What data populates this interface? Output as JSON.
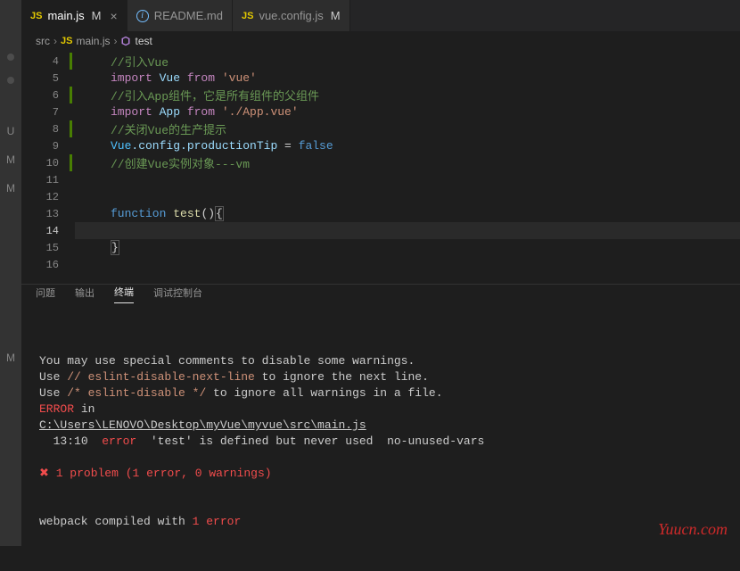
{
  "activity": {
    "letters": [
      "U",
      "M",
      "M"
    ],
    "lower_letter": "M"
  },
  "tabs": [
    {
      "icon": "JS",
      "label": "main.js",
      "mod": "M",
      "active": true,
      "close": true
    },
    {
      "icon": "info",
      "label": "README.md",
      "mod": "",
      "active": false,
      "close": false
    },
    {
      "icon": "JS",
      "label": "vue.config.js",
      "mod": "M",
      "active": false,
      "close": false
    }
  ],
  "breadcrumb": {
    "folder": "src",
    "file_icon": "JS",
    "file": "main.js",
    "symbol": "test"
  },
  "lines": {
    "l4": "//引入Vue",
    "l5_import": "import",
    "l5_var": " Vue ",
    "l5_from": "from",
    "l5_str": " 'vue'",
    "l6": "//引入App组件，它是所有组件的父组件",
    "l7_import": "import",
    "l7_var": " App ",
    "l7_from": "from",
    "l7_str": " './App.vue'",
    "l8": "//关闭Vue的生产提示",
    "l9_obj": "Vue",
    "l9_p1": ".config.",
    "l9_p2": "productionTip",
    "l9_eq": " = ",
    "l9_val": "false",
    "l10": "//创建Vue实例对象---vm",
    "l13_kw": "function",
    "l13_name": " test",
    "l13_paren": "()",
    "l13_brace": "{",
    "l15_brace": "}"
  },
  "nums": [
    "4",
    "5",
    "6",
    "7",
    "8",
    "9",
    "10",
    "11",
    "12",
    "13",
    "14",
    "15",
    "16"
  ],
  "markers": {
    "4": true,
    "6": true,
    "8": true,
    "10": true
  },
  "panel_tabs": {
    "problems": "问题",
    "output": "输出",
    "terminal": "终端",
    "debug": "调试控制台"
  },
  "terminal": {
    "l1a": "You may use special comments to disable some warnings.",
    "l2a": "Use ",
    "l2b": "// eslint-disable-next-line",
    "l2c": " to ignore the next line.",
    "l3a": "Use ",
    "l3b": "/* eslint-disable */",
    "l3c": " to ignore all warnings in a file.",
    "l4a": "ERROR",
    "l4b": " in",
    "l5": "C:\\Users\\LENOVO\\Desktop\\myVue\\myvue\\src\\main.js",
    "l6a": "  13:10  ",
    "l6b": "error",
    "l6c": "  'test' is defined but never used  no-unused-vars",
    "l8x": "✖ ",
    "l8": "1 problem (1 error, 0 warnings)",
    "l10a": "webpack compiled with ",
    "l10b": "1 error"
  },
  "watermark": "Yuucn.com"
}
